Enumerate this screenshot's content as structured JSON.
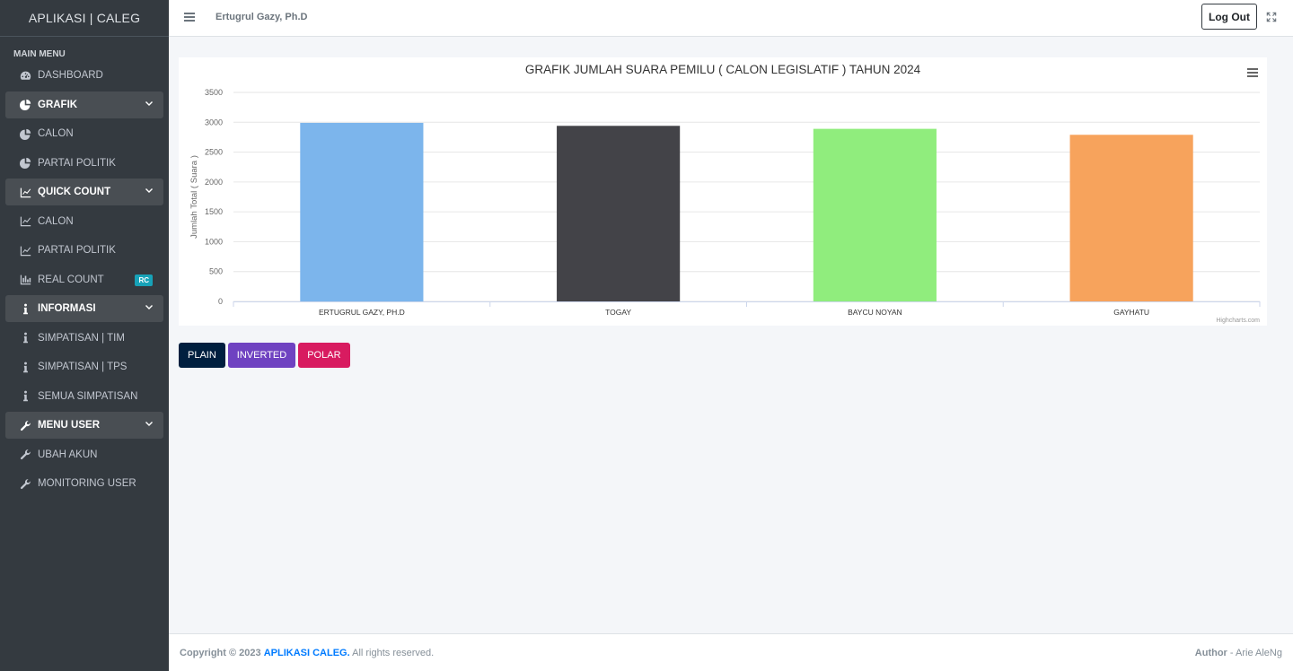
{
  "sidebar": {
    "brand": "APLIKASI | CALEG",
    "menu_header": "MAIN MENU",
    "items": [
      {
        "label": "DASHBOARD",
        "icon": "tachometer-icon"
      },
      {
        "label": "GRAFIK",
        "icon": "pie-chart-icon",
        "parent": true
      },
      {
        "label": "CALON",
        "icon": "pie-chart-icon"
      },
      {
        "label": "PARTAI POLITIK",
        "icon": "pie-chart-icon"
      },
      {
        "label": "QUICK COUNT",
        "icon": "line-chart-icon",
        "parent": true
      },
      {
        "label": "CALON",
        "icon": "line-chart-icon"
      },
      {
        "label": "PARTAI POLITIK",
        "icon": "line-chart-icon"
      },
      {
        "label": "REAL COUNT",
        "icon": "bar-chart-icon",
        "badge": "RC"
      },
      {
        "label": "INFORMASI",
        "icon": "info-icon",
        "parent": true
      },
      {
        "label": "SIMPATISAN | TIM",
        "icon": "info-icon"
      },
      {
        "label": "SIMPATISAN | TPS",
        "icon": "info-icon"
      },
      {
        "label": "SEMUA SIMPATISAN",
        "icon": "info-icon"
      },
      {
        "label": "MENU USER",
        "icon": "wrench-icon",
        "parent": true
      },
      {
        "label": "UBAH AKUN",
        "icon": "wrench-icon"
      },
      {
        "label": "MONITORING USER",
        "icon": "wrench-icon"
      }
    ]
  },
  "topbar": {
    "user_name": "Ertugrul Gazy, Ph.D",
    "logout_label": "Log Out"
  },
  "buttons": {
    "plain": "PLAIN",
    "inverted": "INVERTED",
    "polar": "POLAR"
  },
  "footer": {
    "copyright": "Copyright © 2023",
    "app_link": "APLIKASI CALEG.",
    "rights": "All rights reserved.",
    "author_label": "Author",
    "author_name": "- Arie AleNg"
  },
  "chart_data": {
    "type": "bar",
    "title": "GRAFIK JUMLAH SUARA PEMILU ( CALON LEGISLATIF ) TAHUN 2024",
    "ylabel": "Jumlah Total ( Suara )",
    "xlabel": "",
    "credit": "Highcharts.com",
    "categories": [
      "ERTUGRUL GAZY, PH.D",
      "TOGAY",
      "BAYCU NOYAN",
      "GAYHATU"
    ],
    "values": [
      2990,
      2940,
      2890,
      2790
    ],
    "colors": [
      "#7cb5ec",
      "#434348",
      "#90ed7d",
      "#f7a35c"
    ],
    "ylim": [
      0,
      3500
    ],
    "yticks": [
      0,
      500,
      1000,
      1500,
      2000,
      2500,
      3000,
      3500
    ],
    "grid": true
  }
}
